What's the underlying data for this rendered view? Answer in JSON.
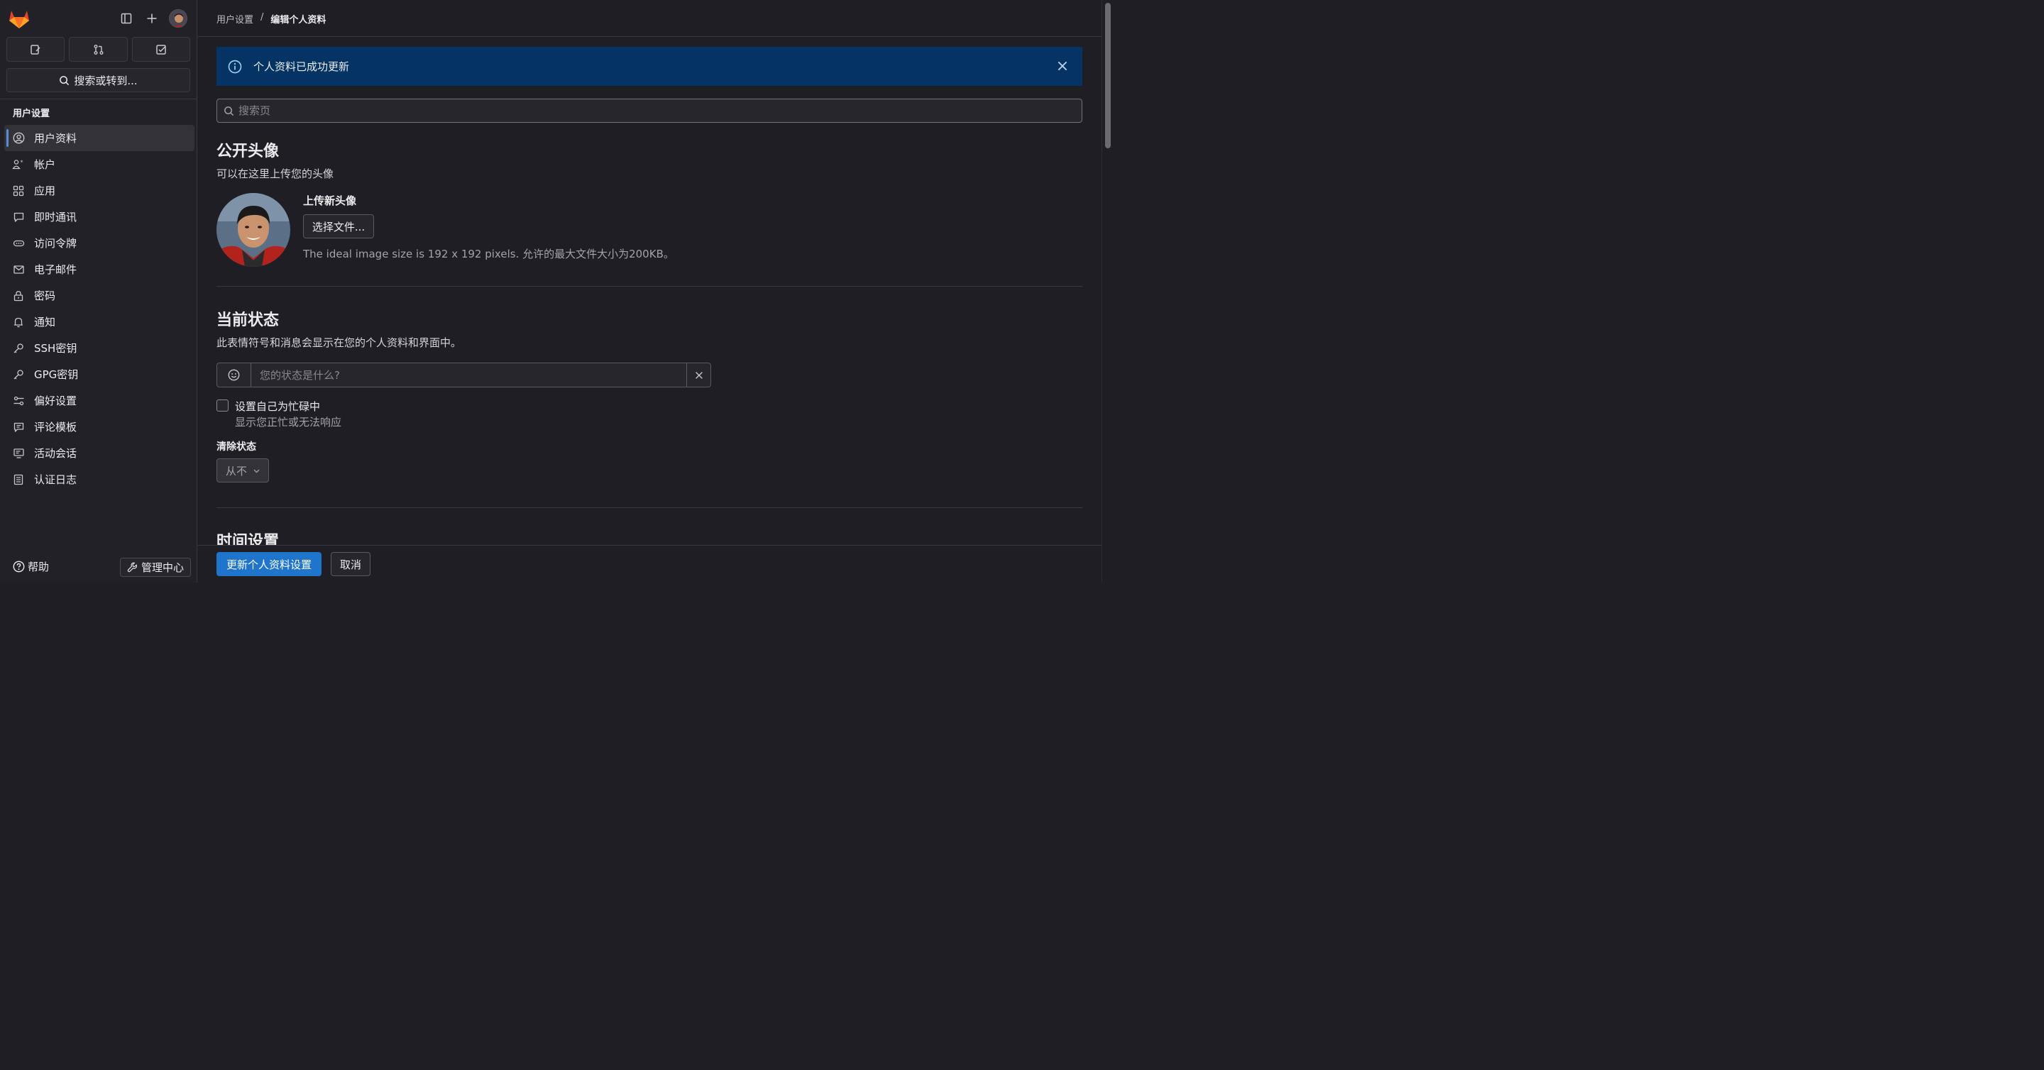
{
  "sidebar": {
    "search_label": "搜索或转到...",
    "section_title": "用户设置",
    "items": [
      {
        "label": "用户资料",
        "icon": "profile-icon",
        "active": true
      },
      {
        "label": "帐户",
        "icon": "account-icon"
      },
      {
        "label": "应用",
        "icon": "applications-icon"
      },
      {
        "label": "即时通讯",
        "icon": "chat-icon"
      },
      {
        "label": "访问令牌",
        "icon": "token-icon"
      },
      {
        "label": "电子邮件",
        "icon": "mail-icon"
      },
      {
        "label": "密码",
        "icon": "lock-icon"
      },
      {
        "label": "通知",
        "icon": "bell-icon"
      },
      {
        "label": "SSH密钥",
        "icon": "key-icon"
      },
      {
        "label": "GPG密钥",
        "icon": "key-icon"
      },
      {
        "label": "偏好设置",
        "icon": "preferences-icon"
      },
      {
        "label": "评论模板",
        "icon": "comment-icon"
      },
      {
        "label": "活动会话",
        "icon": "monitor-icon"
      },
      {
        "label": "认证日志",
        "icon": "log-icon"
      }
    ],
    "help_label": "帮助",
    "admin_label": "管理中心"
  },
  "breadcrumb": {
    "parent": "用户设置",
    "separator": "/",
    "current": "编辑个人资料"
  },
  "alert": {
    "message": "个人资料已成功更新"
  },
  "search": {
    "placeholder": "搜索页"
  },
  "avatar_section": {
    "title": "公开头像",
    "description": "可以在这里上传您的头像",
    "upload_label": "上传新头像",
    "choose_file_label": "选择文件...",
    "hint": "The ideal image size is 192 x 192 pixels. 允许的最大文件大小为200KB。"
  },
  "status_section": {
    "title": "当前状态",
    "description": "此表情符号和消息会显示在您的个人资料和界面中。",
    "input_placeholder": "您的状态是什么?",
    "busy_label": "设置自己为忙碌中",
    "busy_help": "显示您正忙或无法响应",
    "clear_label": "清除状态",
    "clear_value": "从不"
  },
  "time_section": {
    "title": "时间设置"
  },
  "footer": {
    "update_label": "更新个人资料设置",
    "cancel_label": "取消"
  },
  "colors": {
    "accent": "#1f75cb",
    "alert_bg": "#033464",
    "background": "#1f1e24",
    "sidebar_bg": "#232128",
    "logo_orange": "#e24329"
  }
}
